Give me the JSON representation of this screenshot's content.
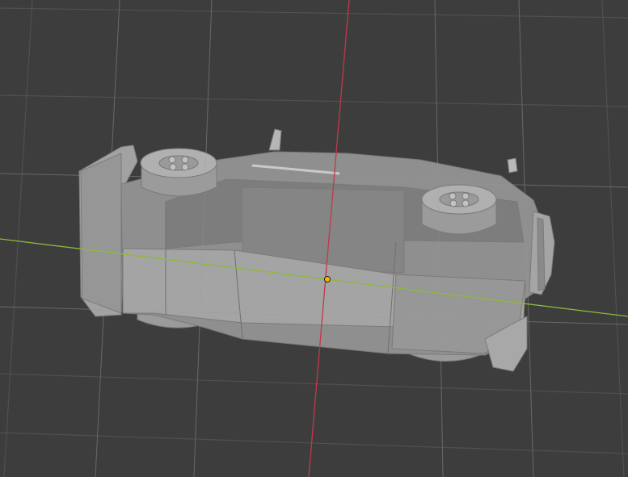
{
  "viewport": {
    "background": "#3d3d3d",
    "grid_color": "#4e4e4e",
    "x_axis_color": "#8fba3a",
    "y_axis_color": "#c0394b",
    "origin_color": "#f4b400",
    "mesh_color": "#8e8e8e",
    "mesh_shade_light": "#9a9a9a",
    "mesh_shade_dark": "#737373",
    "object_type": "car-mesh",
    "view": "bottom-perspective"
  }
}
